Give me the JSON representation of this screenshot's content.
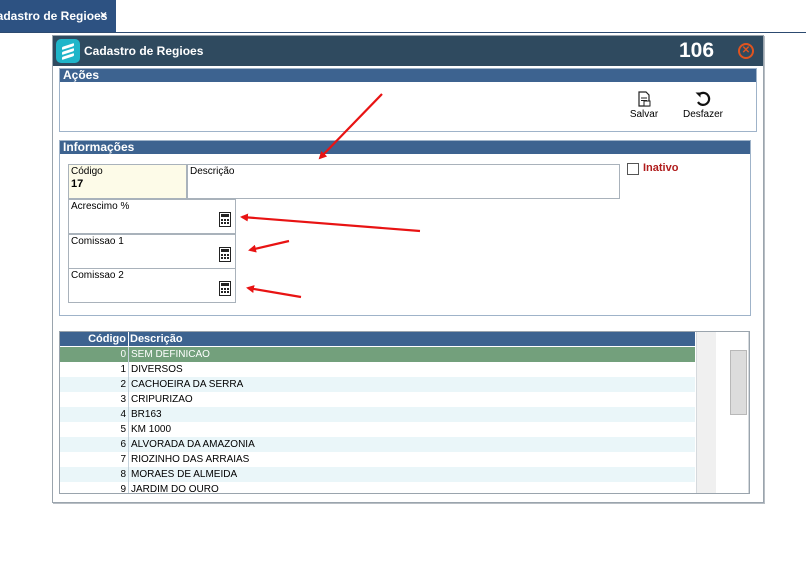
{
  "tab": {
    "label": "Cadastro de Regioes",
    "close_glyph": "×"
  },
  "window": {
    "title": "Cadastro de Regioes",
    "code": "106",
    "close_glyph": "✕"
  },
  "actions": {
    "title": "Ações",
    "save_label": "Salvar",
    "undo_label": "Desfazer"
  },
  "info": {
    "title": "Informações",
    "codigo_label": "Código",
    "codigo_value": "17",
    "descricao_label": "Descrição",
    "descricao_value": "",
    "inativo_label": "Inativo",
    "inativo_checked": false,
    "acrescimo_label": "Acrescimo %",
    "comissao1_label": "Comissao 1",
    "comissao2_label": "Comissao 2"
  },
  "grid": {
    "headers": {
      "codigo": "Código",
      "descricao": "Descrição"
    },
    "rows": [
      {
        "codigo": "0",
        "descricao": "SEM DEFINICAO"
      },
      {
        "codigo": "1",
        "descricao": "DIVERSOS"
      },
      {
        "codigo": "2",
        "descricao": "CACHOEIRA DA SERRA"
      },
      {
        "codigo": "3",
        "descricao": "CRIPURIZAO"
      },
      {
        "codigo": "4",
        "descricao": "BR163"
      },
      {
        "codigo": "5",
        "descricao": "KM 1000"
      },
      {
        "codigo": "6",
        "descricao": "ALVORADA DA AMAZONIA"
      },
      {
        "codigo": "7",
        "descricao": "RIOZINHO DAS ARRAIAS"
      },
      {
        "codigo": "8",
        "descricao": "MORAES DE ALMEIDA"
      },
      {
        "codigo": "9",
        "descricao": "JARDIM DO OURO"
      }
    ]
  },
  "colors": {
    "header_blue": "#3d6390",
    "titlebar": "#2f4a5f",
    "selected_row": "#73a07c",
    "annotation_arrow": "#e81313",
    "inativo_text": "#b01c1c"
  },
  "icons": {
    "app": "app-logo-icon",
    "save": "save-document-icon",
    "undo": "undo-icon",
    "calculator": "calculator-icon",
    "close": "close-circle-icon"
  }
}
